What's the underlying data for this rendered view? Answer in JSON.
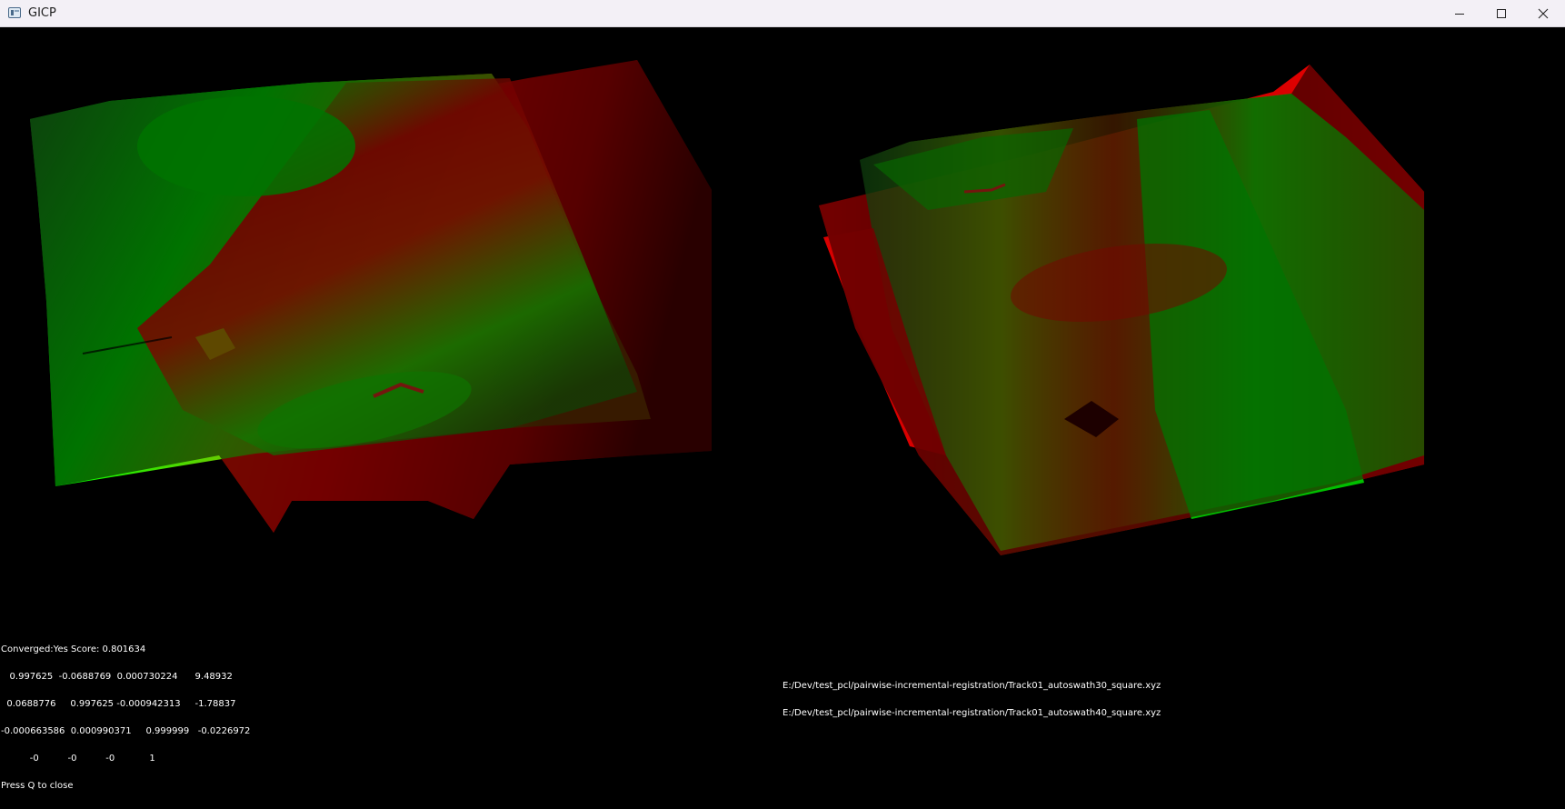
{
  "window": {
    "title": "GICP",
    "controls": [
      "minimize",
      "maximize",
      "close"
    ]
  },
  "overlay_left": {
    "converged_line": "Converged:Yes Score: 0.801634",
    "matrix_rows": [
      "   0.997625  -0.0688769  0.000730224      9.48932",
      "  0.0688776     0.997625 -0.000942313     -1.78837",
      "-0.000663586  0.000990371     0.999999   -0.0226972",
      "          -0          -0          -0            1"
    ],
    "hint": "Press Q to close"
  },
  "overlay_right": {
    "file_1": "E:/Dev/test_pcl/pairwise-incremental-registration/Track01_autoswath30_square.xyz",
    "file_2": "E:/Dev/test_pcl/pairwise-incremental-registration/Track01_autoswath40_square.xyz"
  },
  "colors": {
    "source_cloud": "#00ff00",
    "target_cloud": "#ff0000",
    "background": "#000000",
    "overlay_text": "#ffffff"
  }
}
